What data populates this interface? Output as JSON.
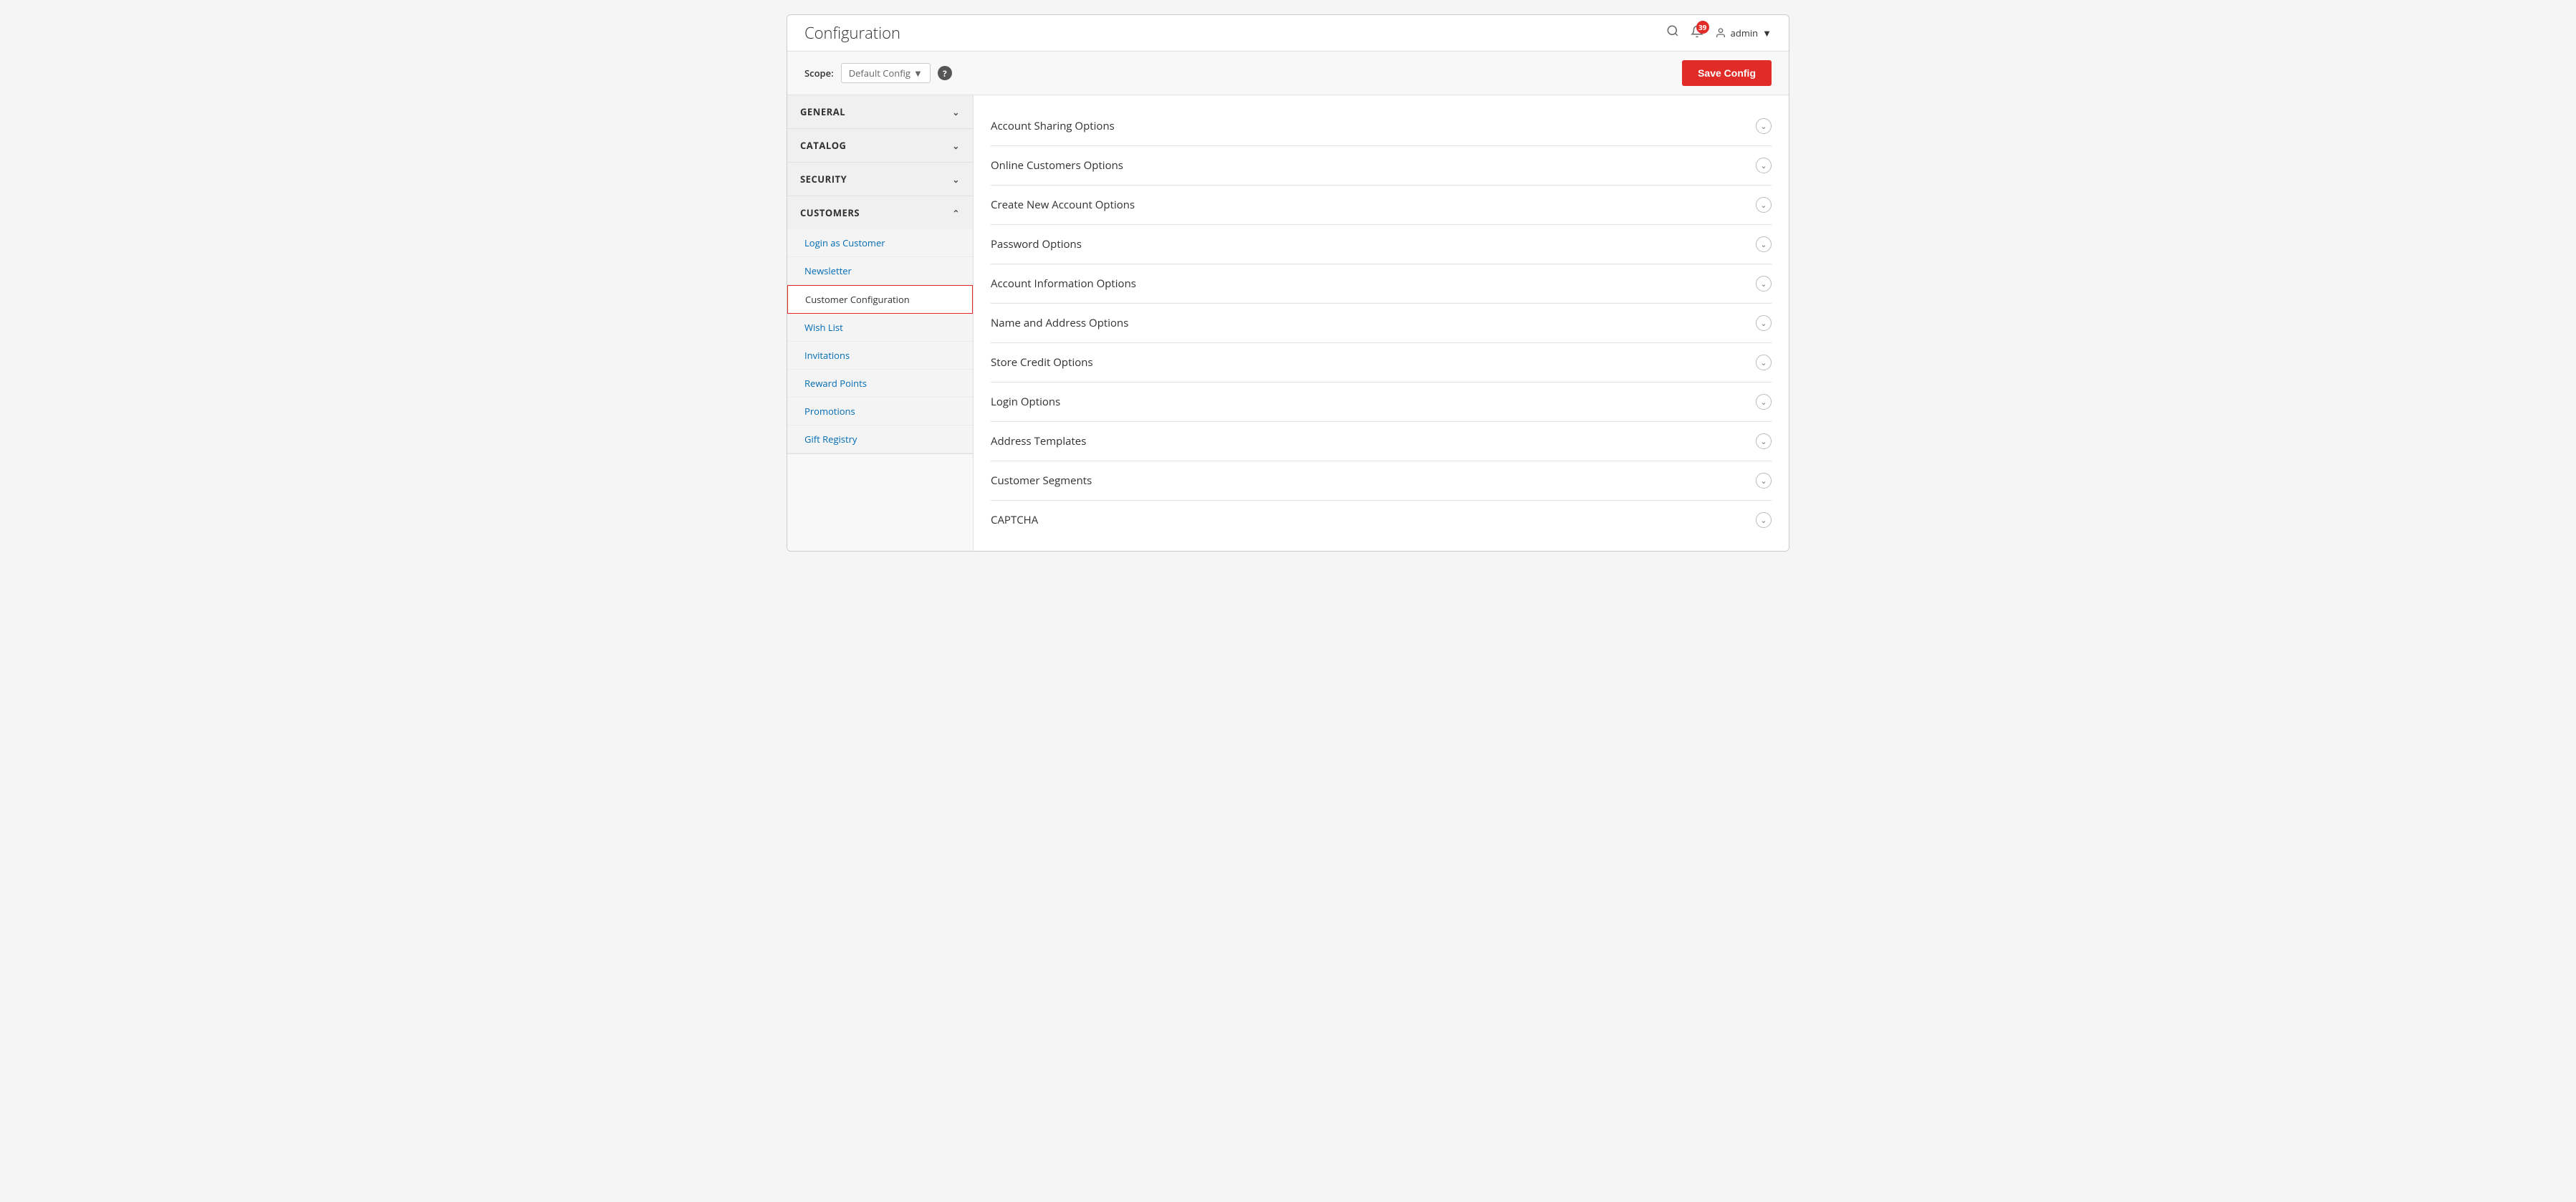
{
  "header": {
    "title": "Configuration",
    "notification_count": "39",
    "admin_label": "admin",
    "search_icon": "🔍",
    "bell_icon": "🔔",
    "user_icon": "👤"
  },
  "scope_bar": {
    "scope_label": "Scope:",
    "scope_value": "Default Config",
    "help_icon": "?",
    "save_button": "Save Config"
  },
  "sidebar": {
    "sections": [
      {
        "id": "general",
        "label": "GENERAL",
        "expanded": false
      },
      {
        "id": "catalog",
        "label": "CATALOG",
        "expanded": false
      },
      {
        "id": "security",
        "label": "SECURITY",
        "expanded": false
      },
      {
        "id": "customers",
        "label": "CUSTOMERS",
        "expanded": true,
        "items": [
          {
            "id": "login-as-customer",
            "label": "Login as Customer",
            "active": false
          },
          {
            "id": "newsletter",
            "label": "Newsletter",
            "active": false
          },
          {
            "id": "customer-configuration",
            "label": "Customer Configuration",
            "active": true
          },
          {
            "id": "wish-list",
            "label": "Wish List",
            "active": false
          },
          {
            "id": "invitations",
            "label": "Invitations",
            "active": false
          },
          {
            "id": "reward-points",
            "label": "Reward Points",
            "active": false
          },
          {
            "id": "promotions",
            "label": "Promotions",
            "active": false
          },
          {
            "id": "gift-registry",
            "label": "Gift Registry",
            "active": false
          }
        ]
      }
    ]
  },
  "main": {
    "config_sections": [
      {
        "id": "account-sharing",
        "title": "Account Sharing Options"
      },
      {
        "id": "online-customers",
        "title": "Online Customers Options"
      },
      {
        "id": "create-new-account",
        "title": "Create New Account Options"
      },
      {
        "id": "password-options",
        "title": "Password Options"
      },
      {
        "id": "account-info",
        "title": "Account Information Options"
      },
      {
        "id": "name-address",
        "title": "Name and Address Options"
      },
      {
        "id": "store-credit",
        "title": "Store Credit Options"
      },
      {
        "id": "login-options",
        "title": "Login Options"
      },
      {
        "id": "address-templates",
        "title": "Address Templates"
      },
      {
        "id": "customer-segments",
        "title": "Customer Segments"
      },
      {
        "id": "captcha",
        "title": "CAPTCHA"
      }
    ]
  }
}
